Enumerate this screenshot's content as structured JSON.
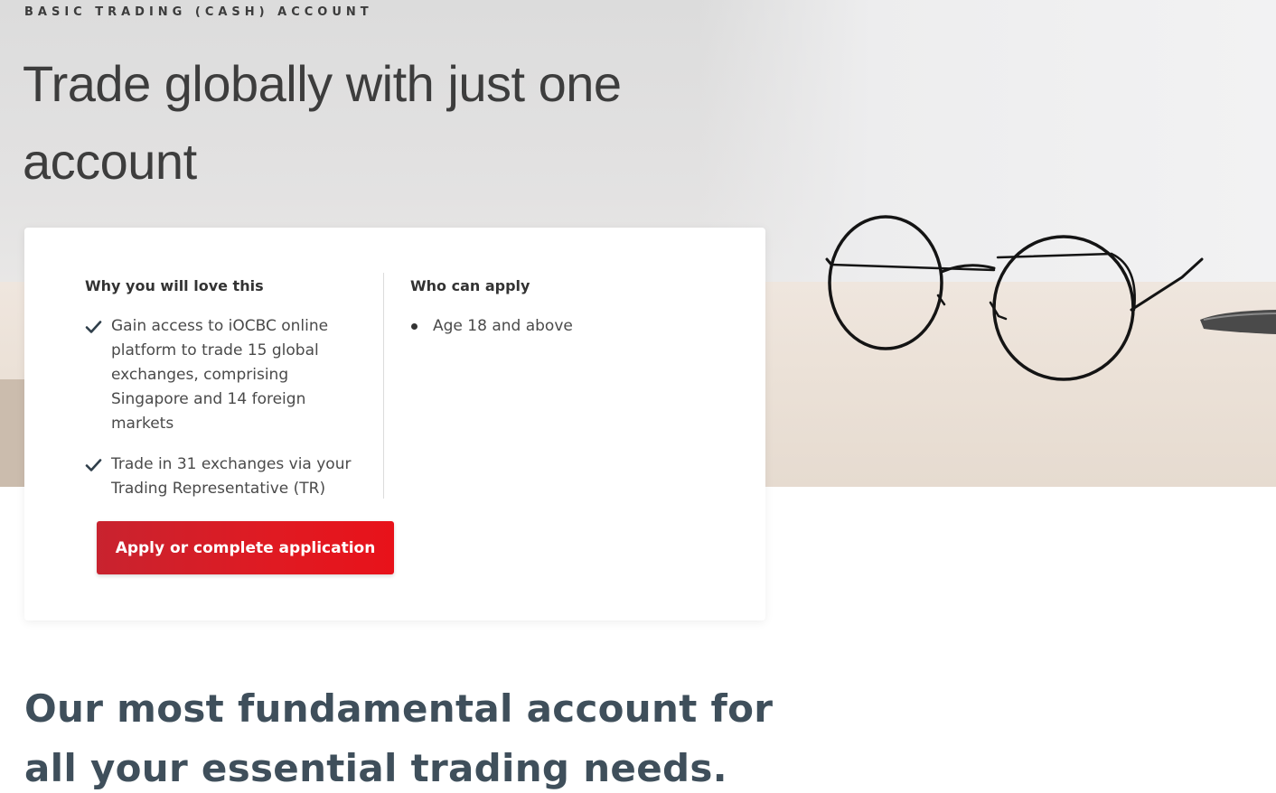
{
  "hero": {
    "eyebrow": "BASIC TRADING (CASH) ACCOUNT",
    "title": "Trade globally with just one account"
  },
  "card": {
    "why": {
      "heading": "Why you will love this",
      "items": [
        "Gain access to iOCBC online platform to trade 15 global exchanges, comprising Singapore and 14 foreign markets",
        "Trade in 31 exchanges via your Trading Representative (TR)"
      ]
    },
    "who": {
      "heading": "Who can apply",
      "items": [
        "Age 18 and above"
      ]
    },
    "cta_label": "Apply or complete application"
  },
  "section": {
    "title": "Our most fundamental account for all your essential trading needs."
  },
  "colors": {
    "accent_red": "#e01a22",
    "section_title": "#3f4f5b",
    "hero_title": "#3d3d3d"
  },
  "icons": [
    "check-icon",
    "bullet-dot"
  ]
}
